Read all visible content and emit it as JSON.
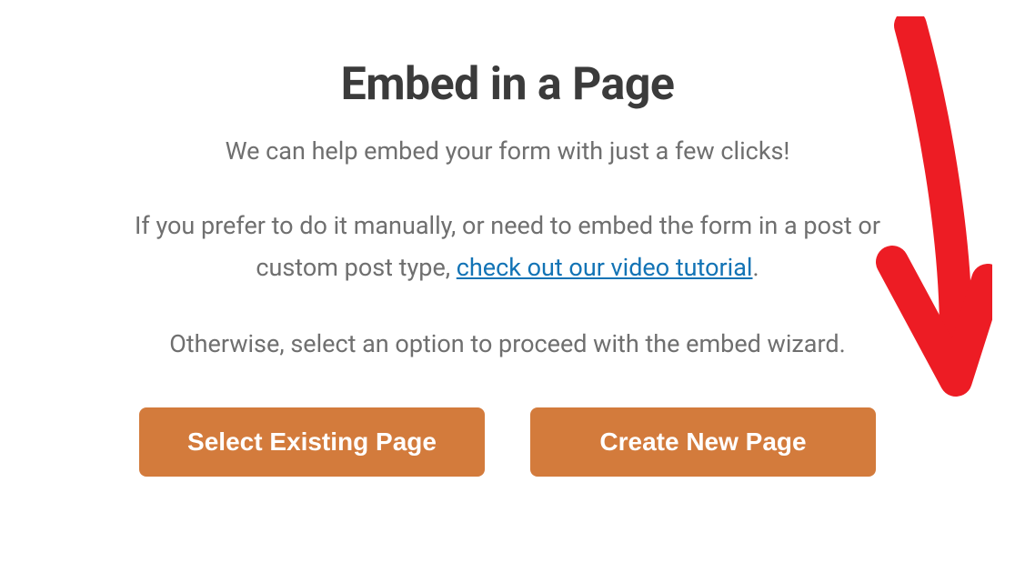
{
  "modal": {
    "title": "Embed in a Page",
    "subtitle": "We can help embed your form with just a few clicks!",
    "paragraph_prefix": "If you prefer to do it manually, or need to embed the form in a post or custom post type, ",
    "tutorial_link_text": "check out our video tutorial",
    "paragraph_suffix": ".",
    "note": "Otherwise, select an option to proceed with the embed wizard.",
    "buttons": {
      "select_existing_label": "Select Existing Page",
      "create_new_label": "Create New Page"
    }
  }
}
